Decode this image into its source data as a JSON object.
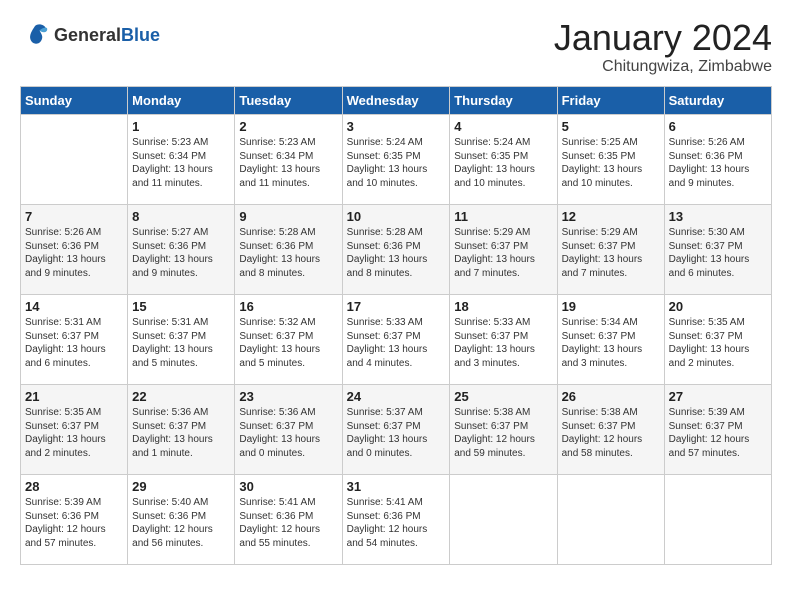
{
  "logo": {
    "general": "General",
    "blue": "Blue"
  },
  "title": "January 2024",
  "subtitle": "Chitungwiza, Zimbabwe",
  "days_header": [
    "Sunday",
    "Monday",
    "Tuesday",
    "Wednesday",
    "Thursday",
    "Friday",
    "Saturday"
  ],
  "weeks": [
    [
      {
        "day": "",
        "sunrise": "",
        "sunset": "",
        "daylight": ""
      },
      {
        "day": "1",
        "sunrise": "Sunrise: 5:23 AM",
        "sunset": "Sunset: 6:34 PM",
        "daylight": "Daylight: 13 hours and 11 minutes."
      },
      {
        "day": "2",
        "sunrise": "Sunrise: 5:23 AM",
        "sunset": "Sunset: 6:34 PM",
        "daylight": "Daylight: 13 hours and 11 minutes."
      },
      {
        "day": "3",
        "sunrise": "Sunrise: 5:24 AM",
        "sunset": "Sunset: 6:35 PM",
        "daylight": "Daylight: 13 hours and 10 minutes."
      },
      {
        "day": "4",
        "sunrise": "Sunrise: 5:24 AM",
        "sunset": "Sunset: 6:35 PM",
        "daylight": "Daylight: 13 hours and 10 minutes."
      },
      {
        "day": "5",
        "sunrise": "Sunrise: 5:25 AM",
        "sunset": "Sunset: 6:35 PM",
        "daylight": "Daylight: 13 hours and 10 minutes."
      },
      {
        "day": "6",
        "sunrise": "Sunrise: 5:26 AM",
        "sunset": "Sunset: 6:36 PM",
        "daylight": "Daylight: 13 hours and 9 minutes."
      }
    ],
    [
      {
        "day": "7",
        "sunrise": "Sunrise: 5:26 AM",
        "sunset": "Sunset: 6:36 PM",
        "daylight": "Daylight: 13 hours and 9 minutes."
      },
      {
        "day": "8",
        "sunrise": "Sunrise: 5:27 AM",
        "sunset": "Sunset: 6:36 PM",
        "daylight": "Daylight: 13 hours and 9 minutes."
      },
      {
        "day": "9",
        "sunrise": "Sunrise: 5:28 AM",
        "sunset": "Sunset: 6:36 PM",
        "daylight": "Daylight: 13 hours and 8 minutes."
      },
      {
        "day": "10",
        "sunrise": "Sunrise: 5:28 AM",
        "sunset": "Sunset: 6:36 PM",
        "daylight": "Daylight: 13 hours and 8 minutes."
      },
      {
        "day": "11",
        "sunrise": "Sunrise: 5:29 AM",
        "sunset": "Sunset: 6:37 PM",
        "daylight": "Daylight: 13 hours and 7 minutes."
      },
      {
        "day": "12",
        "sunrise": "Sunrise: 5:29 AM",
        "sunset": "Sunset: 6:37 PM",
        "daylight": "Daylight: 13 hours and 7 minutes."
      },
      {
        "day": "13",
        "sunrise": "Sunrise: 5:30 AM",
        "sunset": "Sunset: 6:37 PM",
        "daylight": "Daylight: 13 hours and 6 minutes."
      }
    ],
    [
      {
        "day": "14",
        "sunrise": "Sunrise: 5:31 AM",
        "sunset": "Sunset: 6:37 PM",
        "daylight": "Daylight: 13 hours and 6 minutes."
      },
      {
        "day": "15",
        "sunrise": "Sunrise: 5:31 AM",
        "sunset": "Sunset: 6:37 PM",
        "daylight": "Daylight: 13 hours and 5 minutes."
      },
      {
        "day": "16",
        "sunrise": "Sunrise: 5:32 AM",
        "sunset": "Sunset: 6:37 PM",
        "daylight": "Daylight: 13 hours and 5 minutes."
      },
      {
        "day": "17",
        "sunrise": "Sunrise: 5:33 AM",
        "sunset": "Sunset: 6:37 PM",
        "daylight": "Daylight: 13 hours and 4 minutes."
      },
      {
        "day": "18",
        "sunrise": "Sunrise: 5:33 AM",
        "sunset": "Sunset: 6:37 PM",
        "daylight": "Daylight: 13 hours and 3 minutes."
      },
      {
        "day": "19",
        "sunrise": "Sunrise: 5:34 AM",
        "sunset": "Sunset: 6:37 PM",
        "daylight": "Daylight: 13 hours and 3 minutes."
      },
      {
        "day": "20",
        "sunrise": "Sunrise: 5:35 AM",
        "sunset": "Sunset: 6:37 PM",
        "daylight": "Daylight: 13 hours and 2 minutes."
      }
    ],
    [
      {
        "day": "21",
        "sunrise": "Sunrise: 5:35 AM",
        "sunset": "Sunset: 6:37 PM",
        "daylight": "Daylight: 13 hours and 2 minutes."
      },
      {
        "day": "22",
        "sunrise": "Sunrise: 5:36 AM",
        "sunset": "Sunset: 6:37 PM",
        "daylight": "Daylight: 13 hours and 1 minute."
      },
      {
        "day": "23",
        "sunrise": "Sunrise: 5:36 AM",
        "sunset": "Sunset: 6:37 PM",
        "daylight": "Daylight: 13 hours and 0 minutes."
      },
      {
        "day": "24",
        "sunrise": "Sunrise: 5:37 AM",
        "sunset": "Sunset: 6:37 PM",
        "daylight": "Daylight: 13 hours and 0 minutes."
      },
      {
        "day": "25",
        "sunrise": "Sunrise: 5:38 AM",
        "sunset": "Sunset: 6:37 PM",
        "daylight": "Daylight: 12 hours and 59 minutes."
      },
      {
        "day": "26",
        "sunrise": "Sunrise: 5:38 AM",
        "sunset": "Sunset: 6:37 PM",
        "daylight": "Daylight: 12 hours and 58 minutes."
      },
      {
        "day": "27",
        "sunrise": "Sunrise: 5:39 AM",
        "sunset": "Sunset: 6:37 PM",
        "daylight": "Daylight: 12 hours and 57 minutes."
      }
    ],
    [
      {
        "day": "28",
        "sunrise": "Sunrise: 5:39 AM",
        "sunset": "Sunset: 6:36 PM",
        "daylight": "Daylight: 12 hours and 57 minutes."
      },
      {
        "day": "29",
        "sunrise": "Sunrise: 5:40 AM",
        "sunset": "Sunset: 6:36 PM",
        "daylight": "Daylight: 12 hours and 56 minutes."
      },
      {
        "day": "30",
        "sunrise": "Sunrise: 5:41 AM",
        "sunset": "Sunset: 6:36 PM",
        "daylight": "Daylight: 12 hours and 55 minutes."
      },
      {
        "day": "31",
        "sunrise": "Sunrise: 5:41 AM",
        "sunset": "Sunset: 6:36 PM",
        "daylight": "Daylight: 12 hours and 54 minutes."
      },
      {
        "day": "",
        "sunrise": "",
        "sunset": "",
        "daylight": ""
      },
      {
        "day": "",
        "sunrise": "",
        "sunset": "",
        "daylight": ""
      },
      {
        "day": "",
        "sunrise": "",
        "sunset": "",
        "daylight": ""
      }
    ]
  ]
}
